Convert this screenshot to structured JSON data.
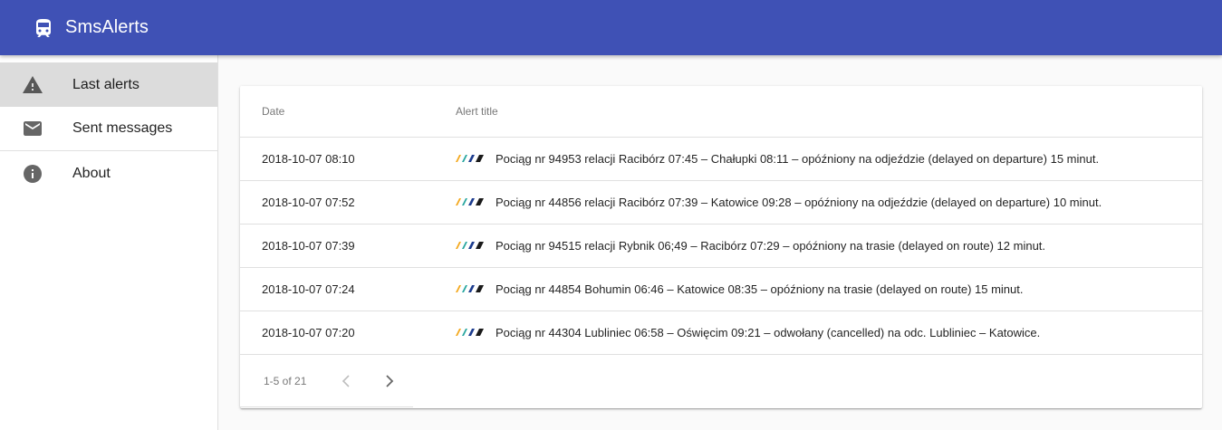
{
  "app": {
    "title": "SmsAlerts",
    "logo_icon": "train-icon",
    "accent_color": "#3f51b5"
  },
  "sidebar": {
    "items": [
      {
        "label": "Last alerts",
        "icon": "warning-icon",
        "active": true
      },
      {
        "label": "Sent messages",
        "icon": "mail-icon",
        "active": false
      },
      {
        "label": "About",
        "icon": "info-icon",
        "active": false
      }
    ]
  },
  "table": {
    "columns": [
      "Date",
      "Alert title"
    ],
    "rows": [
      {
        "date": "2018-10-07 08:10",
        "title": "Pociąg nr 94953 relacji Racibórz 07:45 – Chałupki 08:11 – opóźniony na odjeździe (delayed on departure) 15 minut."
      },
      {
        "date": "2018-10-07 07:52",
        "title": "Pociąg nr 44856 relacji Racibórz 07:39 – Katowice 09:28 – opóźniony na odjeździe (delayed on departure) 10 minut."
      },
      {
        "date": "2018-10-07 07:39",
        "title": "Pociąg nr 94515 relacji Rybnik 06;49 – Racibórz 07:29 – opóźniony na trasie (delayed on route) 12 minut."
      },
      {
        "date": "2018-10-07 07:24",
        "title": "Pociąg nr 44854 Bohumin 06:46 – Katowice 08:35 – opóźniony na trasie (delayed on route) 15 minut."
      },
      {
        "date": "2018-10-07 07:20",
        "title": "Pociąg nr 44304 Lubliniec 06:58 – Oświęcim 09:21 – odwołany (cancelled) na odc. Lubliniec – Katowice."
      }
    ],
    "row_icon": "koleje-slaskie-stripes-icon"
  },
  "paginator": {
    "range_label": "1-5 of 21",
    "prev_icon": "chevron-left-icon",
    "next_icon": "chevron-right-icon"
  }
}
